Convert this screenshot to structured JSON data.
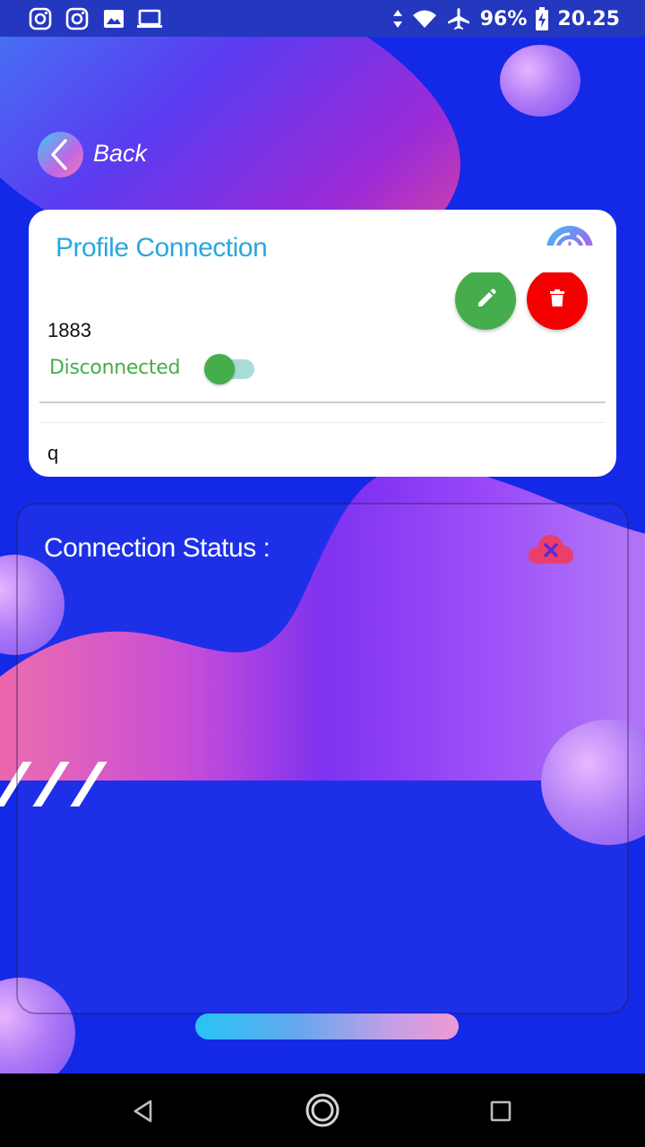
{
  "status_bar": {
    "left_icons": [
      "instagram-icon",
      "instagram-icon",
      "gallery-icon",
      "laptop-icon"
    ],
    "battery": "96%",
    "time": "20.25",
    "right_icons": [
      "data-arrows-icon",
      "wifi-icon",
      "airplane-icon",
      "battery-charging-icon"
    ]
  },
  "header": {
    "back_label": "Back"
  },
  "profile_card": {
    "title": "Profile Connection",
    "port": "1883",
    "connection_state": "Disconnected",
    "topic": "q",
    "toggle_on": true,
    "colors": {
      "title": "#2aa7e0",
      "edit": "#45ad4c",
      "delete": "#f40000",
      "status": "#45ad4c"
    }
  },
  "status_card": {
    "title": "Connection Status :",
    "status_icon": "cloud-disconnected-icon",
    "icon_color": "#ea3f69"
  },
  "nav_bar": {
    "buttons": [
      "back-icon",
      "home-icon",
      "recents-icon"
    ]
  }
}
